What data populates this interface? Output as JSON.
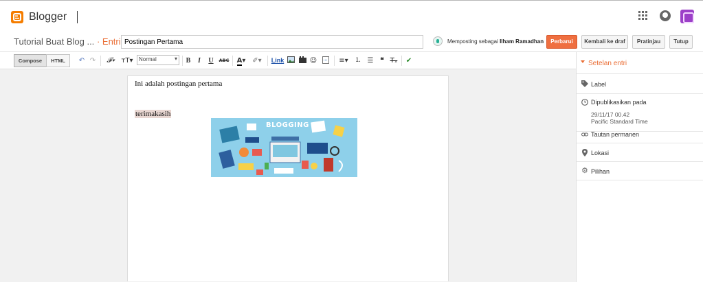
{
  "app": {
    "brand": "Blogger"
  },
  "header": {
    "blog_title": "Tutorial Buat Blog ...",
    "separator": "·",
    "section": "Entri",
    "post_title_value": "Postingan Pertama",
    "posting_as_prefix": "Memposting sebagai",
    "posting_as_user": "Ilham Ramadhan"
  },
  "actions": {
    "publish": "Perbarui",
    "revert": "Kembali ke draf",
    "preview": "Pratinjau",
    "close": "Tutup"
  },
  "toolbar": {
    "compose": "Compose",
    "html": "HTML",
    "format": "Normal",
    "bold": "B",
    "italic": "I",
    "underline": "U",
    "strike": "ABC",
    "link": "Link"
  },
  "editor": {
    "line1": "Ini adalah postingan pertama",
    "line2": "terimakasih",
    "image_text": "BLOGGING"
  },
  "sidebar": {
    "heading": "Setelan entri",
    "label": "Label",
    "published_label": "Dipublikasikan pada",
    "published_date": "29/11/17 00.42",
    "published_tz": "Pacific Standard Time",
    "permalink": "Tautan permanen",
    "location": "Lokasi",
    "options": "Pilihan"
  },
  "colors": {
    "accent": "#ea6d34",
    "primary_button": "#ef6f40",
    "brand_logo": "#f57d00",
    "avatar": "#9c40c8",
    "hero_background": "#8ed0ea"
  },
  "icons": [
    "apps-grid-icon",
    "notifications-icon",
    "account-avatar",
    "undo-icon",
    "redo-icon",
    "font-icon",
    "font-size-icon",
    "text-color-icon",
    "highlight-icon",
    "image-icon",
    "video-icon",
    "emoji-icon",
    "jump-break-icon",
    "align-icon",
    "numbered-list-icon",
    "bulleted-list-icon",
    "quote-icon",
    "clear-format-icon",
    "spellcheck-icon",
    "tag-icon",
    "clock-icon",
    "link-icon",
    "location-pin-icon",
    "gear-icon"
  ]
}
